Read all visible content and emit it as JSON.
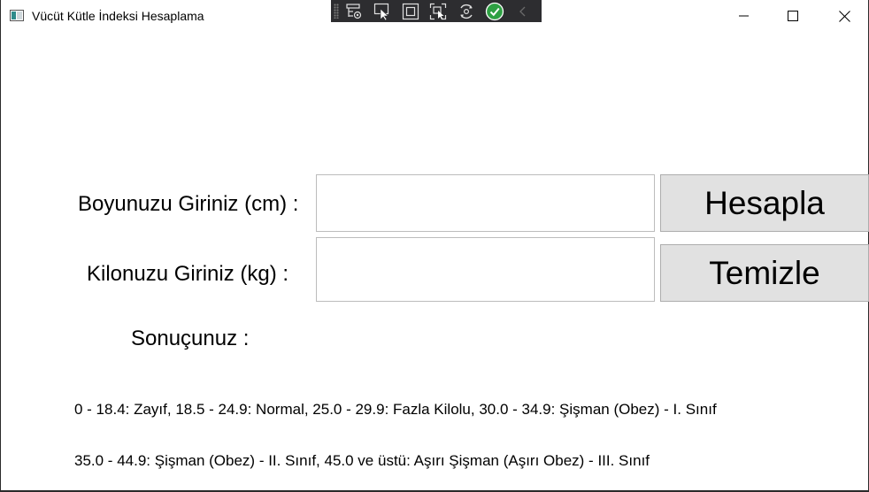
{
  "window": {
    "title": "Vücüt Kütle İndeksi Hesaplama"
  },
  "debug_toolbar": {
    "icons": [
      "live-visual-tree-icon",
      "select-element-icon",
      "display-layout-adorners-icon",
      "track-focused-element-icon",
      "hot-reload-icon",
      "check-accessibility-icon",
      "collapse-toolbar-icon"
    ]
  },
  "form": {
    "height_label": "Boyunuzu Giriniz (cm) :",
    "weight_label": "Kilonuzu Giriniz (kg) :",
    "result_label": "Sonuçunuz :",
    "height_value": "",
    "weight_value": "",
    "calculate_button": "Hesapla",
    "clear_button": "Temizle"
  },
  "info": {
    "line1": "0 - 18.4: Zayıf, 18.5 - 24.9: Normal, 25.0 - 29.9: Fazla Kilolu, 30.0 - 34.9: Şişman (Obez) - I. Sınıf",
    "line2": "35.0 - 44.9: Şişman (Obez) - II. Sınıf, 45.0 ve üstü: Aşırı Şişman (Aşırı Obez) - III. Sınıf"
  }
}
